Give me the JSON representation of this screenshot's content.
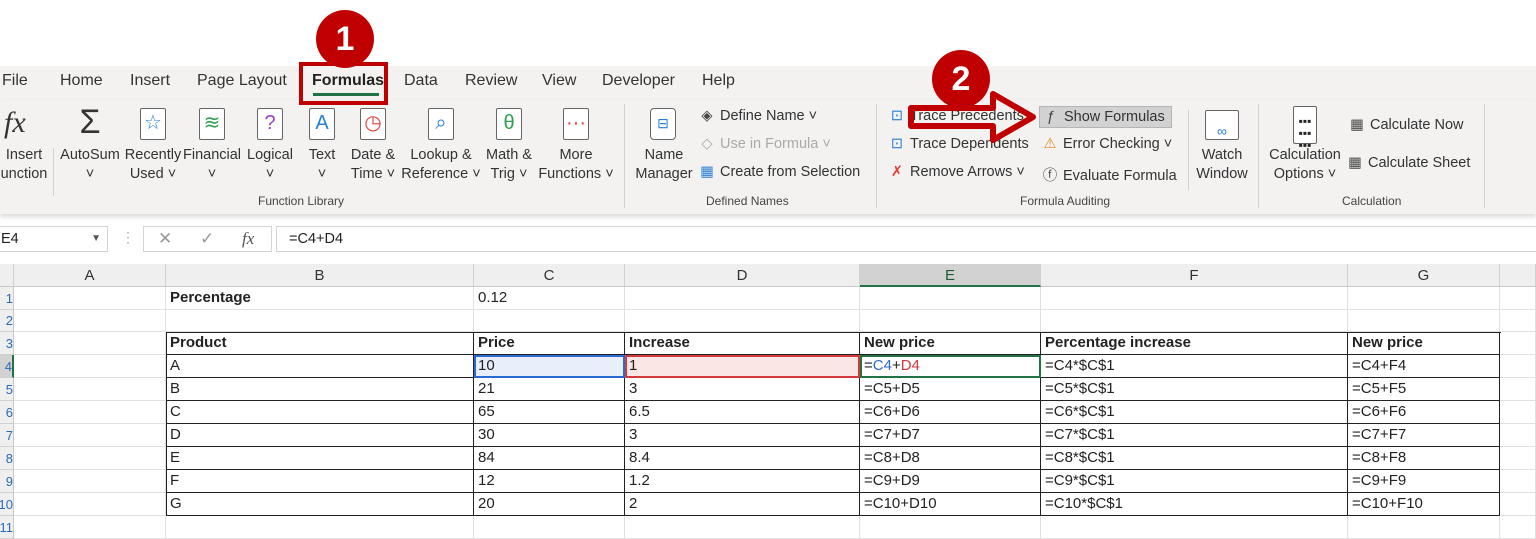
{
  "tabs": [
    "File",
    "Home",
    "Insert",
    "Page Layout",
    "Formulas",
    "Data",
    "Review",
    "View",
    "Developer",
    "Help"
  ],
  "active_tab": "Formulas",
  "ribbon": {
    "insert_function": [
      "Insert",
      "unction"
    ],
    "function_library": [
      {
        "l1": "AutoSum",
        "l2": "˅",
        "icon": "Σ",
        "color": "#333",
        "name": "autosum"
      },
      {
        "l1": "Recently",
        "l2": "Used ˅",
        "icon": "☆",
        "color": "#2a7fd4",
        "name": "recently-used"
      },
      {
        "l1": "Financial",
        "l2": "˅",
        "icon": "≋",
        "color": "#2e9e4f",
        "name": "financial"
      },
      {
        "l1": "Logical",
        "l2": "˅",
        "icon": "?",
        "color": "#9b3fc9",
        "name": "logical"
      },
      {
        "l1": "Text",
        "l2": "˅",
        "icon": "A",
        "color": "#2a7fd4",
        "name": "text"
      },
      {
        "l1": "Date &",
        "l2": "Time ˅",
        "icon": "◷",
        "color": "#e0403a",
        "name": "date-time"
      },
      {
        "l1": "Lookup &",
        "l2": "Reference ˅",
        "icon": "⌕",
        "color": "#2a7fd4",
        "name": "lookup-reference"
      },
      {
        "l1": "Math &",
        "l2": "Trig ˅",
        "icon": "θ",
        "color": "#2e9e4f",
        "name": "math-trig"
      },
      {
        "l1": "More",
        "l2": "Functions ˅",
        "icon": "···",
        "color": "#e0403a",
        "name": "more-functions"
      }
    ],
    "function_library_label": "Function Library",
    "name_manager": [
      "Name",
      "Manager"
    ],
    "define_name": "Define Name  ˅",
    "use_in_formula": "Use in Formula ˅",
    "create_from_selection": "Create from Selection",
    "defined_names_label": "Defined Names",
    "trace_precedents": "Trace Precedents",
    "trace_dependents": "Trace Dependents",
    "remove_arrows": "Remove Arrows  ˅",
    "show_formulas": "Show Formulas",
    "error_checking": "Error Checking  ˅",
    "evaluate_formula": "Evaluate Formula",
    "watch_window": [
      "Watch",
      "Window"
    ],
    "formula_auditing_label": "Formula Auditing",
    "calculation_options": [
      "Calculation",
      "Options ˅"
    ],
    "calculate_now": "Calculate Now",
    "calculate_sheet": "Calculate Sheet",
    "calculation_label": "Calculation"
  },
  "formula_bar": {
    "name_box": "E4",
    "formula": "=C4+D4",
    "fx": "fx",
    "cancel": "✕",
    "enter": "✓"
  },
  "columns": [
    "A",
    "B",
    "C",
    "D",
    "E",
    "F",
    "G"
  ],
  "rows": [
    "1",
    "2",
    "3",
    "4",
    "5",
    "6",
    "7",
    "8",
    "9",
    "10",
    "11"
  ],
  "cells": {
    "B1": "Percentage",
    "C1": "0.12",
    "table_header": [
      "Product",
      "Price",
      "Increase",
      "New price",
      "Percentage increase",
      "New price"
    ],
    "table_rows": [
      [
        "A",
        "10",
        "1",
        "=C4+D4",
        "=C4*$C$1",
        "=C4+F4"
      ],
      [
        "B",
        "21",
        "3",
        "=C5+D5",
        "=C5*$C$1",
        "=C5+F5"
      ],
      [
        "C",
        "65",
        "6.5",
        "=C6+D6",
        "=C6*$C$1",
        "=C6+F6"
      ],
      [
        "D",
        "30",
        "3",
        "=C7+D7",
        "=C7*$C$1",
        "=C7+F7"
      ],
      [
        "E",
        "84",
        "8.4",
        "=C8+D8",
        "=C8*$C$1",
        "=C8+F8"
      ],
      [
        "F",
        "12",
        "1.2",
        "=C9+D9",
        "=C9*$C$1",
        "=C9+F9"
      ],
      [
        "G",
        "20",
        "2",
        "=C10+D10",
        "=C10*$C$1",
        "=C10+F10"
      ]
    ],
    "E4_parts": [
      "=",
      "C4",
      "+",
      "D4"
    ]
  },
  "annotations": {
    "step1": "1",
    "step2": "2",
    "color": "#c00000"
  },
  "colors": {
    "accent": "#217346",
    "precedent_blue": "#2a6ad4",
    "precedent_red": "#d43a3a"
  }
}
